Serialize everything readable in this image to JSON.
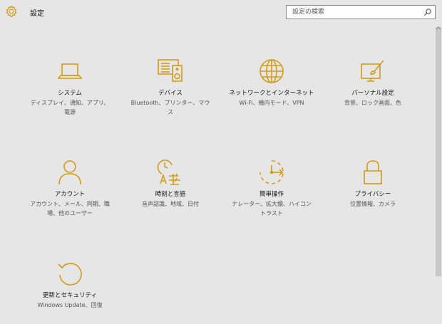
{
  "app": {
    "title": "設定"
  },
  "search": {
    "placeholder": "設定の検索"
  },
  "colors": {
    "accent": "#d39b17",
    "background": "#e6e6e6"
  },
  "tiles": [
    {
      "icon": "laptop-icon",
      "title": "システム",
      "desc": "ディスプレイ、通知、アプリ、電源"
    },
    {
      "icon": "devices-icon",
      "title": "デバイス",
      "desc": "Bluetooth、プリンター、マウス"
    },
    {
      "icon": "globe-icon",
      "title": "ネットワークとインターネット",
      "desc": "Wi-Fi、機内モード、VPN"
    },
    {
      "icon": "personalization-icon",
      "title": "パーソナル設定",
      "desc": "背景、ロック画面、色"
    },
    {
      "icon": "person-icon",
      "title": "アカウント",
      "desc": "アカウント、メール、同期、職場、他のユーザー"
    },
    {
      "icon": "time-language-icon",
      "title": "時刻と言語",
      "desc": "音声認識、地域、日付"
    },
    {
      "icon": "ease-of-access-icon",
      "title": "簡単操作",
      "desc": "ナレーター、拡大鏡、ハイコントラスト"
    },
    {
      "icon": "lock-icon",
      "title": "プライバシー",
      "desc": "位置情報、カメラ"
    },
    {
      "icon": "update-icon",
      "title": "更新とセキュリティ",
      "desc": "Windows Update、回復"
    }
  ]
}
